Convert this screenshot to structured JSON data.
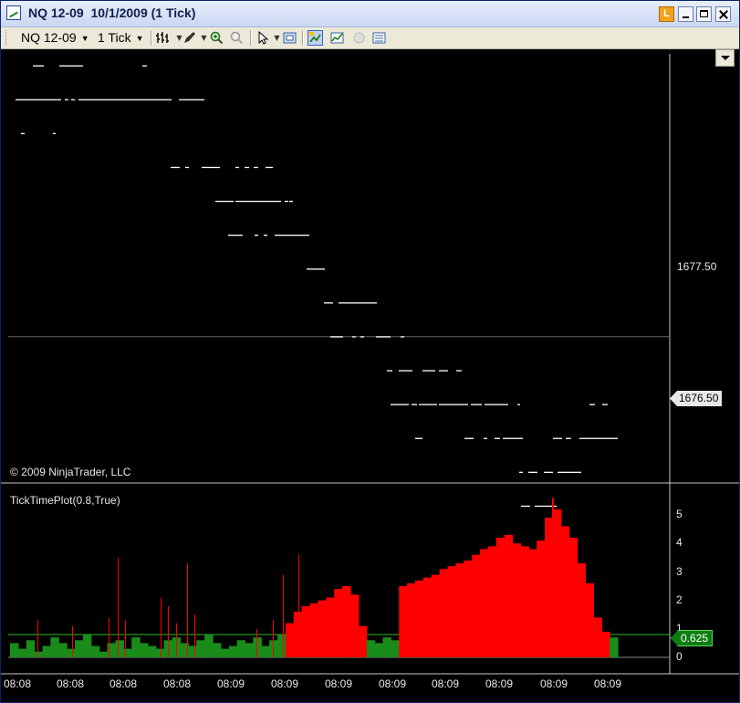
{
  "window": {
    "title": "NQ 12-09  10/1/2009 (1 Tick)",
    "buttons": {
      "lock": "L"
    }
  },
  "toolbar": {
    "instrument": "NQ 12-09",
    "interval": "1 Tick",
    "icons": [
      "bar-type-icon",
      "pencil-draw-icon",
      "zoom-in-icon",
      "zoom-out-icon",
      "pointer-icon",
      "snapshot-icon",
      "properties-icon",
      "indicator-icon",
      "circle-disabled-icon",
      "data-box-icon"
    ]
  },
  "chart": {
    "copyright": "© 2009 NinjaTrader, LLC",
    "price_labels": [
      {
        "text": "1677.50",
        "value": 1677.5
      },
      {
        "text": "1676.50",
        "value": 1676.5
      }
    ],
    "last_price_tag": "1676.50"
  },
  "indicator": {
    "label": "TickTimePlot(0.8,True)",
    "y_ticks": [
      "5",
      "4",
      "3",
      "2",
      "1",
      "0"
    ],
    "threshold": 0.8,
    "value_tag": "0.625"
  },
  "x_axis": {
    "labels": [
      "08:08",
      "08:08",
      "08:08",
      "08:08",
      "08:09",
      "08:09",
      "08:09",
      "08:09",
      "08:09",
      "08:09",
      "08:09",
      "08:09"
    ]
  },
  "colors": {
    "background": "#000000",
    "up_fill": "#ff0000",
    "down_fill": "#1a8c1a",
    "threshold_line": "#2db52d",
    "price_line": "#ffffff"
  },
  "chart_data": {
    "type": "area",
    "price_levels": [
      1679.5,
      1679.25,
      1679.0,
      1678.75,
      1678.5,
      1678.25,
      1678.0,
      1677.75,
      1677.5,
      1677.25,
      1677.0,
      1676.75,
      1676.5,
      1676.25,
      1676.0
    ],
    "indicator_samples": [
      0.5,
      0.3,
      0.6,
      0.2,
      0.4,
      0.7,
      0.5,
      0.3,
      0.6,
      0.8,
      0.4,
      0.2,
      0.5,
      0.6,
      0.3,
      0.7,
      0.5,
      0.4,
      0.3,
      0.6,
      0.7,
      0.5,
      0.4,
      0.6,
      0.8,
      0.5,
      0.3,
      0.4,
      0.6,
      0.5,
      0.7,
      0.4,
      0.6,
      0.8,
      1.2,
      1.6,
      1.8,
      1.9,
      2.0,
      2.1,
      2.4,
      2.5,
      2.2,
      1.1,
      0.6,
      0.5,
      0.7,
      0.6,
      2.5,
      2.6,
      2.7,
      2.8,
      2.9,
      3.1,
      3.2,
      3.3,
      3.4,
      3.6,
      3.8,
      3.9,
      4.2,
      4.3,
      4.0,
      3.9,
      3.8,
      4.1,
      4.9,
      5.2,
      4.6,
      4.2,
      3.3,
      2.6,
      1.4,
      0.9,
      0.7
    ]
  }
}
